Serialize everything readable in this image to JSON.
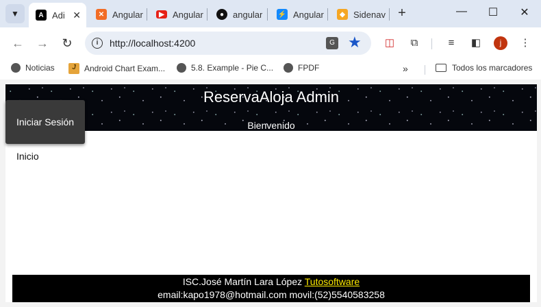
{
  "browser": {
    "tabs": [
      {
        "title": "Adi",
        "favicon": "angular-icon",
        "active": true
      },
      {
        "title": "Angular",
        "favicon": "xampp-icon"
      },
      {
        "title": "Angular",
        "favicon": "youtube-icon"
      },
      {
        "title": "angular",
        "favicon": "github-icon"
      },
      {
        "title": "Angular",
        "favicon": "stackblitz-icon"
      },
      {
        "title": "Sidenav",
        "favicon": "shield-icon"
      }
    ],
    "new_tab_label": "+",
    "address": "http://localhost:4200",
    "profile_initial": "j",
    "bookmarks": [
      {
        "label": "Noticias"
      },
      {
        "label": "Android Chart Exam..."
      },
      {
        "label": "5.8. Example - Pie C..."
      },
      {
        "label": "FPDF"
      }
    ],
    "all_bookmarks_label": "Todos los marcadores",
    "colors": {
      "profile": "#c1340e",
      "star": "#1a56c8"
    }
  },
  "page": {
    "header_title": "ReservaAloja Admin",
    "header_subtitle": "Bienvenido",
    "login_button": "Iniciar Sesión",
    "nav_home": "Inicio",
    "footer": {
      "author": "ISC.José Martín Lara López",
      "company": "Tutosoftware",
      "contact": "email:kapo1978@hotmail.com movil:(52)5540583258"
    },
    "colors": {
      "header_bg": "#05070d",
      "button_bg": "#3a3a3a",
      "footer_link": "#ffeb00"
    }
  }
}
